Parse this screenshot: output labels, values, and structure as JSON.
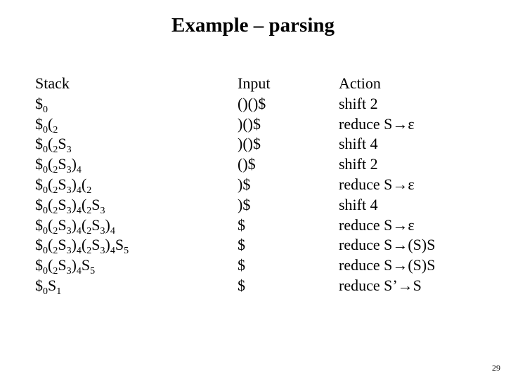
{
  "slide": {
    "title": "Example – parsing",
    "page_number": "29"
  },
  "table": {
    "headers": {
      "stack": "Stack",
      "input": "Input",
      "action": "Action"
    },
    "rows": [
      {
        "stack": [
          {
            "t": "$",
            "s": "0"
          }
        ],
        "input": "()()$",
        "action": "shift 2"
      },
      {
        "stack": [
          {
            "t": "$",
            "s": "0"
          },
          {
            "t": "(",
            "s": "2"
          }
        ],
        "input": ")()$",
        "action": "reduce S→ε"
      },
      {
        "stack": [
          {
            "t": "$",
            "s": "0"
          },
          {
            "t": "(",
            "s": "2"
          },
          {
            "t": "S",
            "s": "3"
          }
        ],
        "input": ")()$",
        "action": "shift 4"
      },
      {
        "stack": [
          {
            "t": "$",
            "s": "0"
          },
          {
            "t": "(",
            "s": "2"
          },
          {
            "t": "S",
            "s": "3"
          },
          {
            "t": ")",
            "s": "4"
          }
        ],
        "input": "()$",
        "action": "shift 2"
      },
      {
        "stack": [
          {
            "t": "$",
            "s": "0"
          },
          {
            "t": "(",
            "s": "2"
          },
          {
            "t": "S",
            "s": "3"
          },
          {
            "t": ")",
            "s": "4"
          },
          {
            "t": "(",
            "s": "2"
          }
        ],
        "input": ")$",
        "action": "reduce S→ε"
      },
      {
        "stack": [
          {
            "t": "$",
            "s": "0"
          },
          {
            "t": "(",
            "s": "2"
          },
          {
            "t": "S",
            "s": "3"
          },
          {
            "t": ")",
            "s": "4"
          },
          {
            "t": "(",
            "s": "2"
          },
          {
            "t": "S",
            "s": "3"
          }
        ],
        "input": ")$",
        "action": "shift 4"
      },
      {
        "stack": [
          {
            "t": "$",
            "s": "0"
          },
          {
            "t": "(",
            "s": "2"
          },
          {
            "t": "S",
            "s": "3"
          },
          {
            "t": ")",
            "s": "4"
          },
          {
            "t": "(",
            "s": "2"
          },
          {
            "t": "S",
            "s": "3"
          },
          {
            "t": ")",
            "s": "4"
          }
        ],
        "input": "$",
        "action": "reduce S→ε"
      },
      {
        "stack": [
          {
            "t": "$",
            "s": "0"
          },
          {
            "t": "(",
            "s": "2"
          },
          {
            "t": "S",
            "s": "3"
          },
          {
            "t": ")",
            "s": "4"
          },
          {
            "t": "(",
            "s": "2"
          },
          {
            "t": "S",
            "s": "3"
          },
          {
            "t": ")",
            "s": "4"
          },
          {
            "t": "S",
            "s": "5"
          }
        ],
        "input": "$",
        "action": "reduce S→(S)S"
      },
      {
        "stack": [
          {
            "t": "$",
            "s": "0"
          },
          {
            "t": "(",
            "s": "2"
          },
          {
            "t": "S",
            "s": "3"
          },
          {
            "t": ")",
            "s": "4"
          },
          {
            "t": "S",
            "s": "5"
          }
        ],
        "input": "$",
        "action": "reduce S→(S)S"
      },
      {
        "stack": [
          {
            "t": "$",
            "s": "0"
          },
          {
            "t": "S",
            "s": "1"
          }
        ],
        "input": "$",
        "action": "reduce S’→S"
      }
    ]
  }
}
